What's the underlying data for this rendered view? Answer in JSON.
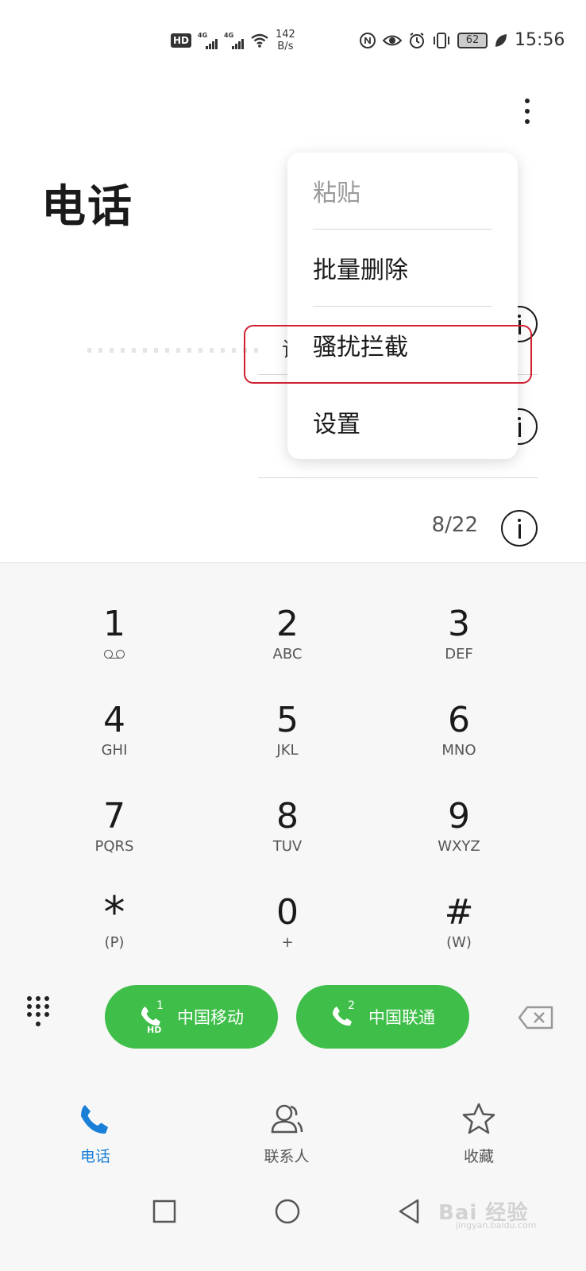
{
  "status_bar": {
    "hd_label": "HD",
    "net_type_1": "4G",
    "net_type_2": "4G",
    "speed_value": "142",
    "speed_unit": "B/s",
    "battery": "62",
    "time": "15:56",
    "icons": [
      "hd-volte-icon",
      "signal-4g-icon",
      "signal-4g-icon",
      "wifi-icon",
      "nfc-icon",
      "eye-comfort-icon",
      "alarm-icon",
      "vibrate-icon",
      "battery-icon",
      "leaf-icon"
    ]
  },
  "header": {
    "title": "电话",
    "more_icon": "more-vertical-icon"
  },
  "menu": {
    "items": [
      {
        "label": "粘贴",
        "enabled": false
      },
      {
        "label": "批量删除",
        "enabled": true
      },
      {
        "label": "骚扰拦截",
        "enabled": true,
        "highlighted": true
      },
      {
        "label": "设置",
        "enabled": true
      }
    ],
    "highlight_color": "#d0202f"
  },
  "call_log": {
    "clipped_text": "请",
    "entries": [
      {
        "date": "",
        "icon": "info-icon"
      },
      {
        "date": "",
        "icon": "info-icon"
      },
      {
        "date": "8/22",
        "icon": "info-icon"
      }
    ]
  },
  "dialer": {
    "keys": [
      {
        "digit": "1",
        "letters": "",
        "icon": "voicemail-icon"
      },
      {
        "digit": "2",
        "letters": "ABC"
      },
      {
        "digit": "3",
        "letters": "DEF"
      },
      {
        "digit": "4",
        "letters": "GHI"
      },
      {
        "digit": "5",
        "letters": "JKL"
      },
      {
        "digit": "6",
        "letters": "MNO"
      },
      {
        "digit": "7",
        "letters": "PQRS"
      },
      {
        "digit": "8",
        "letters": "TUV"
      },
      {
        "digit": "9",
        "letters": "WXYZ"
      },
      {
        "digit": "*",
        "letters": "(P)"
      },
      {
        "digit": "0",
        "letters": "+"
      },
      {
        "digit": "#",
        "letters": "(W)"
      }
    ],
    "sim1": {
      "slot": "1",
      "hd": "HD",
      "label": "中国移动"
    },
    "sim2": {
      "slot": "2",
      "label": "中国联通"
    },
    "call_button_color": "#3fbf4a"
  },
  "bottom_nav": {
    "tabs": [
      {
        "label": "电话",
        "icon": "phone-icon",
        "active": true
      },
      {
        "label": "联系人",
        "icon": "contacts-icon",
        "active": false
      },
      {
        "label": "收藏",
        "icon": "star-icon",
        "active": false
      }
    ],
    "active_color": "#1a7fd6"
  },
  "watermark": {
    "text": "Bai 经验",
    "sub": "jingyan.baidu.com"
  }
}
